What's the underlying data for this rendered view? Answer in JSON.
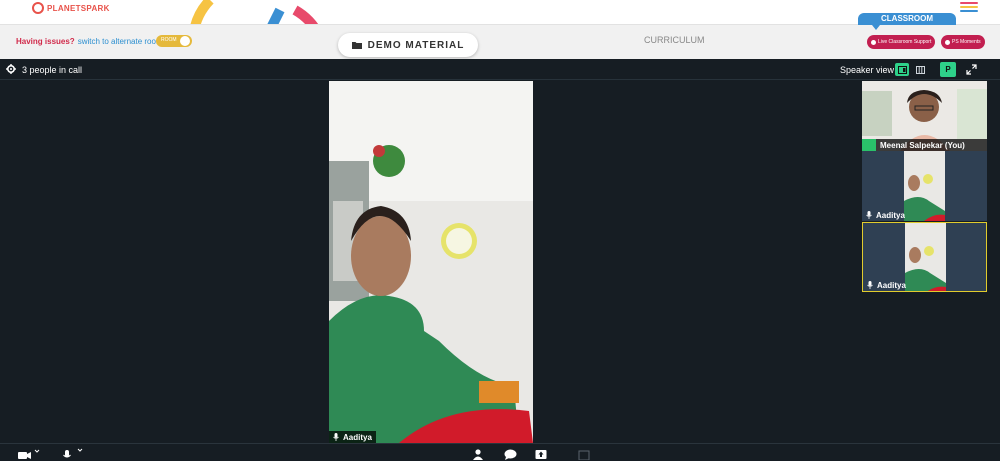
{
  "brand": {
    "name": "PLANETSPARK"
  },
  "header": {
    "issues_question": "Having issues?",
    "switch_link": "switch to alternate room",
    "toggle_label": "ROOM",
    "demo_button": "DEMO MATERIAL",
    "curriculum_tab": "CURRICULUM",
    "classroom_tab": "CLASSROOM",
    "live_support": "Live Classroom Support",
    "ps_moments": "PS Moments"
  },
  "call": {
    "participant_count": "3 people in call",
    "view_label": "Speaker view",
    "user_initial": "P",
    "main_speaker": "Aaditya",
    "participants": [
      {
        "name": "Meenal Salpekar (You)"
      },
      {
        "name": "Aaditya"
      },
      {
        "name": "Aaditya"
      }
    ]
  },
  "colors": {
    "accent": "#c21f50",
    "classroom": "#3a8fd3",
    "toggle": "#e5b93b",
    "call_bg": "#161d23",
    "tile_bg": "#2f4053",
    "active_border": "#e1cc2d",
    "view_active": "#2ed18a"
  },
  "icons": [
    "logo-icon",
    "hamburger-icon",
    "folder-icon",
    "gear-icon",
    "speaker-view-icon",
    "grid-view-icon",
    "fullscreen-icon",
    "mic-icon",
    "camera-icon",
    "participants-icon",
    "chat-icon",
    "share-screen-icon"
  ]
}
